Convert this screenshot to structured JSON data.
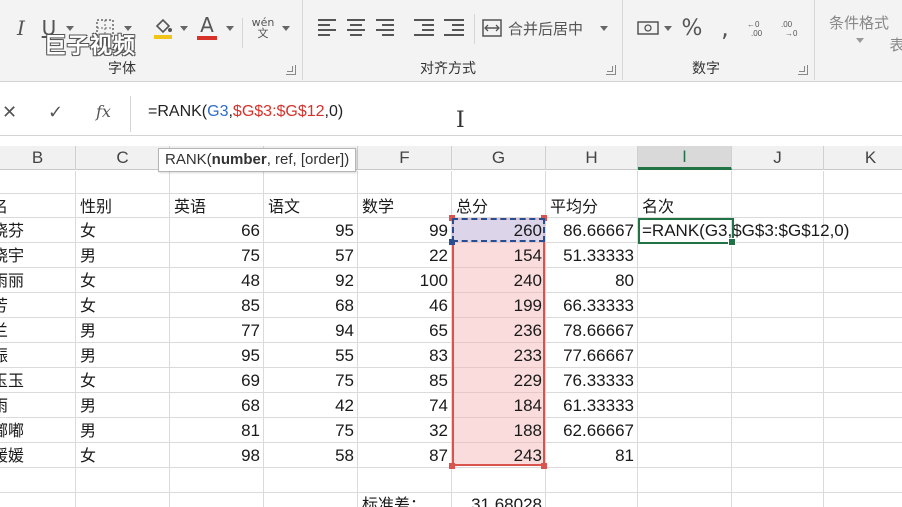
{
  "watermark": "巨子视频",
  "ribbon": {
    "font_group_label": "字体",
    "align_group_label": "对齐方式",
    "number_group_label": "数字",
    "italic": "I",
    "underline": "U",
    "font_color": "A",
    "wen": "wén\n文",
    "merge_label": "合并后居中",
    "percent": "%",
    "comma": ",",
    "cond_format": "条件格式",
    "right_partial": "表"
  },
  "formula_bar": {
    "fx": "fx",
    "formula_prefix": "=RANK(",
    "formula_g3": "G3",
    "formula_comma": ",",
    "formula_range": "$G$3:$G$12",
    "formula_suffix": ",0)"
  },
  "tooltip": {
    "fn": "RANK(",
    "arg1": "number",
    "rest": ", ref, [order])"
  },
  "columns": [
    "B",
    "C",
    "D",
    "E",
    "F",
    "G",
    "H",
    "I",
    "J",
    "K"
  ],
  "headers": {
    "name": "名",
    "gender": "性别",
    "english": "英语",
    "chinese": "语文",
    "math": "数学",
    "total": "总分",
    "avg": "平均分",
    "rank": "名次"
  },
  "rows": [
    {
      "name": "晓芬",
      "gender": "女",
      "english": "66",
      "chinese": "95",
      "math": "99",
      "total": "260",
      "avg": "86.66667"
    },
    {
      "name": "晓宇",
      "gender": "男",
      "english": "75",
      "chinese": "57",
      "math": "22",
      "total": "154",
      "avg": "51.33333"
    },
    {
      "name": "雨丽",
      "gender": "女",
      "english": "48",
      "chinese": "92",
      "math": "100",
      "total": "240",
      "avg": "80"
    },
    {
      "name": "芳",
      "gender": "女",
      "english": "85",
      "chinese": "68",
      "math": "46",
      "total": "199",
      "avg": "66.33333"
    },
    {
      "name": "兰",
      "gender": "男",
      "english": "77",
      "chinese": "94",
      "math": "65",
      "total": "236",
      "avg": "78.66667"
    },
    {
      "name": "振",
      "gender": "男",
      "english": "95",
      "chinese": "55",
      "math": "83",
      "total": "233",
      "avg": "77.66667"
    },
    {
      "name": "玉玉",
      "gender": "女",
      "english": "69",
      "chinese": "75",
      "math": "85",
      "total": "229",
      "avg": "76.33333"
    },
    {
      "name": "雨",
      "gender": "男",
      "english": "68",
      "chinese": "42",
      "math": "74",
      "total": "184",
      "avg": "61.33333"
    },
    {
      "name": "嘟嘟",
      "gender": "男",
      "english": "81",
      "chinese": "75",
      "math": "32",
      "total": "188",
      "avg": "62.66667"
    },
    {
      "name": "媛媛",
      "gender": "女",
      "english": "98",
      "chinese": "58",
      "math": "87",
      "total": "243",
      "avg": "81"
    }
  ],
  "rank_cell_formula": "=RANK(G3,$G$3:$G$12,0)",
  "footer": {
    "std_label": "标准差：",
    "std_value": "31.68028"
  }
}
